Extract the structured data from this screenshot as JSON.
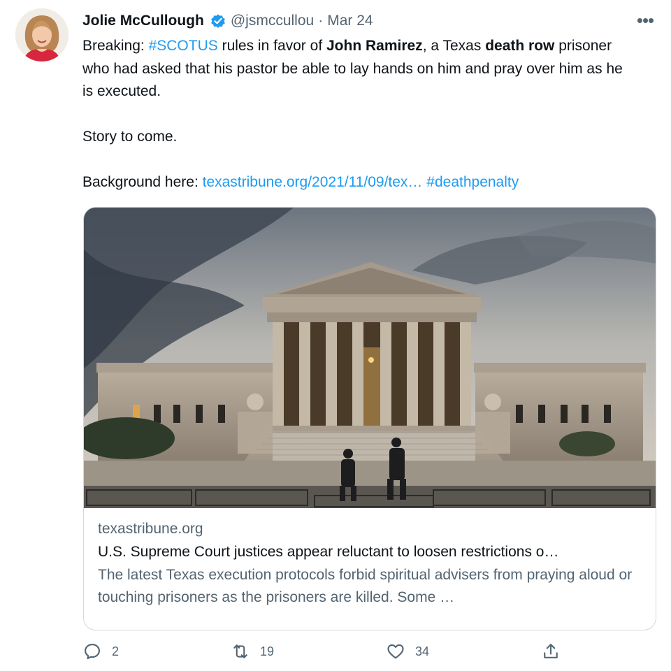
{
  "author": {
    "name": "Jolie McCullough",
    "handle": "@jsmccullou",
    "separator": "·",
    "date": "Mar 24",
    "verified_icon": "verified-badge-icon",
    "avatar_icon": "avatar"
  },
  "more_label": "•••",
  "tweet": {
    "line1_pre": "Breaking: ",
    "hashtag1": "#SCOTUS",
    "line1_mid": " rules in favor of ",
    "bold1": "John Ramirez",
    "line1_mid2": ", a Texas ",
    "bold2": "death row",
    "line1_post": " prisoner who had asked that his pastor be able to lay hands on him and pray over him as he is executed.",
    "line2": "Story to come.",
    "line3_pre": "Background here: ",
    "link": "texastribune.org/2021/11/09/tex…",
    "hashtag2": "#deathpenalty"
  },
  "card": {
    "domain": "texastribune.org",
    "title": "U.S. Supreme Court justices appear reluctant to loosen restrictions o…",
    "description": "The latest Texas execution protocols forbid spiritual advisers from praying aloud or touching prisoners as the prisoners are killed. Some …",
    "image_icon": "supreme-court-photo"
  },
  "actions": {
    "reply_count": "2",
    "retweet_count": "19",
    "like_count": "34"
  },
  "colors": {
    "link": "#1d9bf0",
    "secondary_text": "#536471",
    "border": "#cfd9de"
  }
}
